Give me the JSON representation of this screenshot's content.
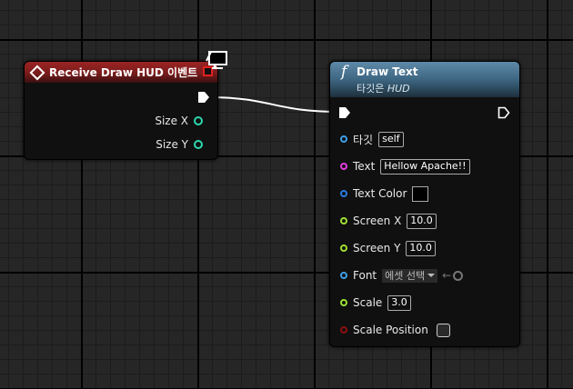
{
  "receive_node": {
    "title": "Receive Draw HUD 이벤트",
    "pins": [
      {
        "label": "Size X",
        "color": "#2dd8b0"
      },
      {
        "label": "Size Y",
        "color": "#2dd8b0"
      }
    ],
    "header_color": "#8b2020"
  },
  "draw_node": {
    "title": "Draw Text",
    "subtitle_prefix": "타깃은 ",
    "subtitle_target": "HUD",
    "header_color": "#4a7a9a",
    "pins": {
      "target": {
        "label": "타깃",
        "value": "self",
        "color": "#3f9fe8"
      },
      "text": {
        "label": "Text",
        "value": "Hellow Apache!!",
        "color": "#e03ee0"
      },
      "text_color": {
        "label": "Text Color",
        "color": "#2a7ae0",
        "swatch": "#000000"
      },
      "screen_x": {
        "label": "Screen X",
        "value": "10.0",
        "color": "#9fe030"
      },
      "screen_y": {
        "label": "Screen Y",
        "value": "10.0",
        "color": "#9fe030"
      },
      "font": {
        "label": "Font",
        "value": "에셋 선택",
        "color": "#3f9fe8"
      },
      "scale": {
        "label": "Scale",
        "value": "3.0",
        "color": "#9fe030"
      },
      "scale_position": {
        "label": "Scale Position",
        "color": "#8a1010",
        "checked": false
      }
    }
  }
}
